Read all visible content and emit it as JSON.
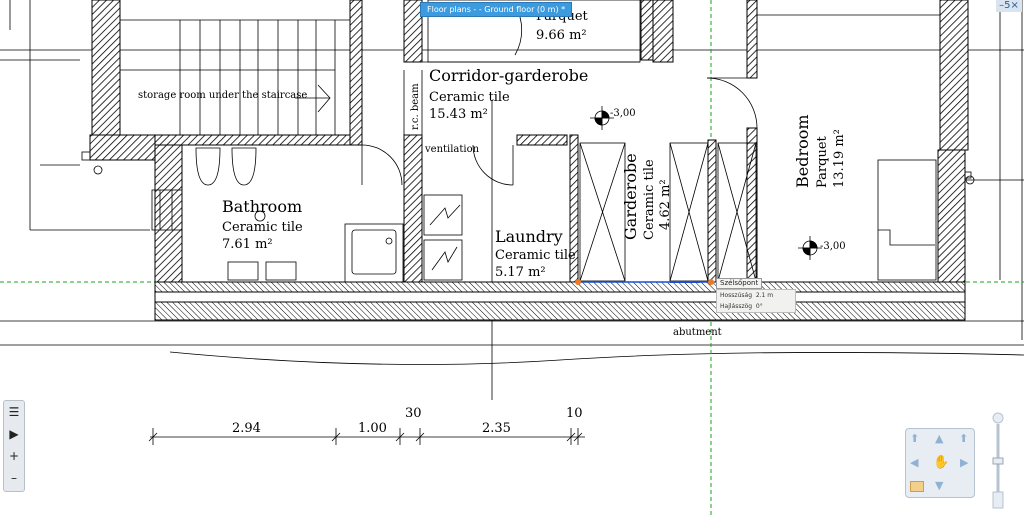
{
  "window": {
    "tab_title": "Floor plans -  - Ground floor (0 m) *",
    "window_buttons": "–5×"
  },
  "rooms": {
    "top": {
      "material": "Parquet",
      "area": "9.66 m²"
    },
    "corridor": {
      "name": "Corridor-garderobe",
      "material": "Ceramic tile",
      "area": "15.43 m²"
    },
    "bathroom": {
      "name": "Bathroom",
      "material": "Ceramic tile",
      "area": "7.61 m²"
    },
    "laundry": {
      "name": "Laundry",
      "material": "Ceramic tile",
      "area": "5.17 m²"
    },
    "garderobe": {
      "name": "Garderobe",
      "material": "Ceramic tile",
      "area": "4.62 m²"
    },
    "bedroom": {
      "name": "Bedroom",
      "material": "Parquet",
      "area": "13.19 m²"
    }
  },
  "labels": {
    "storage": "storage room under the staircase",
    "beam": "r.c. beam",
    "ventilation": "ventilation",
    "abutment": "abutment",
    "level1": "-3,00",
    "level2": "-3,00"
  },
  "dimensions": {
    "d1": "2.94",
    "d2": "1.00",
    "d3": "30",
    "d4": "2.35",
    "d5": "10"
  },
  "tooltip": {
    "title": "Szélsőpont",
    "length_label": "Hosszúság",
    "length_value": "2.1 m",
    "angle_label": "Hajlásszög",
    "angle_value": "0°"
  },
  "left_toolbar": [
    "☰",
    "▶",
    "+",
    "–"
  ],
  "nav": {
    "up": "▲",
    "down": "▼",
    "left": "◀",
    "right": "▶",
    "hand": "✋",
    "corner_up_left": "⬆",
    "corner_up_right": "⬆"
  }
}
